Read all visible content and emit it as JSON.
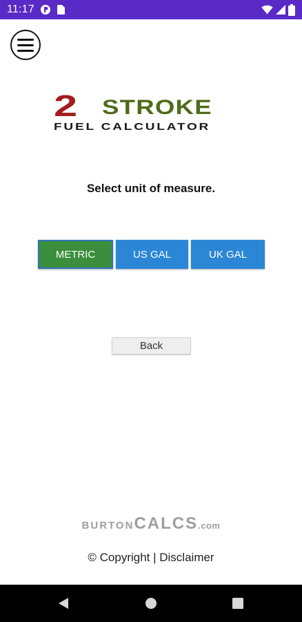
{
  "status_bar": {
    "time": "11:17",
    "icons": [
      "notification-icon",
      "sim-card-icon",
      "wifi-icon",
      "signal-icon",
      "battery-icon"
    ],
    "background": "#5a2ac6"
  },
  "header": {
    "menu_icon": "hamburger-menu-icon"
  },
  "logo": {
    "number": "2",
    "word": "STROKE",
    "subtitle": "FUEL CALCULATOR",
    "colors": {
      "number": "#a31d1d",
      "word": "#4f6b19",
      "subtitle": "#1a1a1a"
    }
  },
  "main": {
    "prompt": "Select unit of measure.",
    "unit_buttons": [
      {
        "label": "METRIC",
        "color": "#3b8e3b",
        "selected": true
      },
      {
        "label": "US GAL",
        "color": "#2b86d6",
        "selected": false
      },
      {
        "label": "UK GAL",
        "color": "#2b86d6",
        "selected": false
      }
    ],
    "back_label": "Back"
  },
  "footer": {
    "brand_part1": "BURTON",
    "brand_part2": "CALCS",
    "brand_part3": ".com",
    "copyright": "© Copyright | Disclaimer"
  },
  "nav_bar": {
    "icons": [
      "back-triangle-icon",
      "home-circle-icon",
      "recents-square-icon"
    ]
  }
}
